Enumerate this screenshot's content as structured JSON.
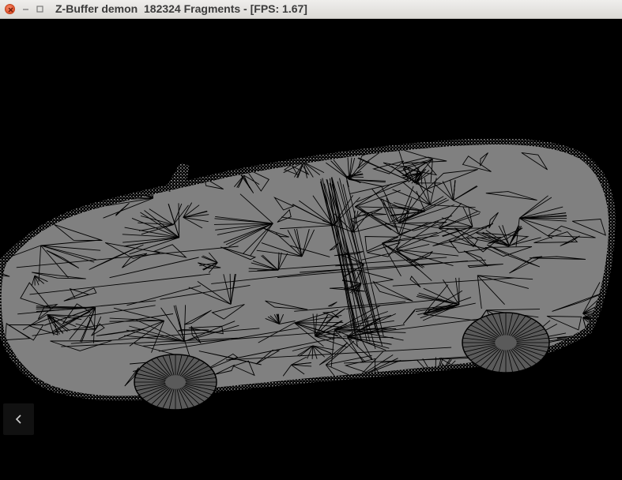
{
  "window": {
    "title": "Z-Buffer demon  182324 Fragments - [FPS: 1.67]"
  },
  "controls": {
    "close_icon": "close-icon",
    "minimize_icon": "minimize-icon",
    "maximize_icon": "maximize-icon"
  },
  "viewport": {
    "background": "#000000",
    "fill_color": "#808080",
    "edge_color": "#000000",
    "subject": "car-mesh"
  },
  "nav": {
    "back_icon": "chevron-left-icon"
  }
}
